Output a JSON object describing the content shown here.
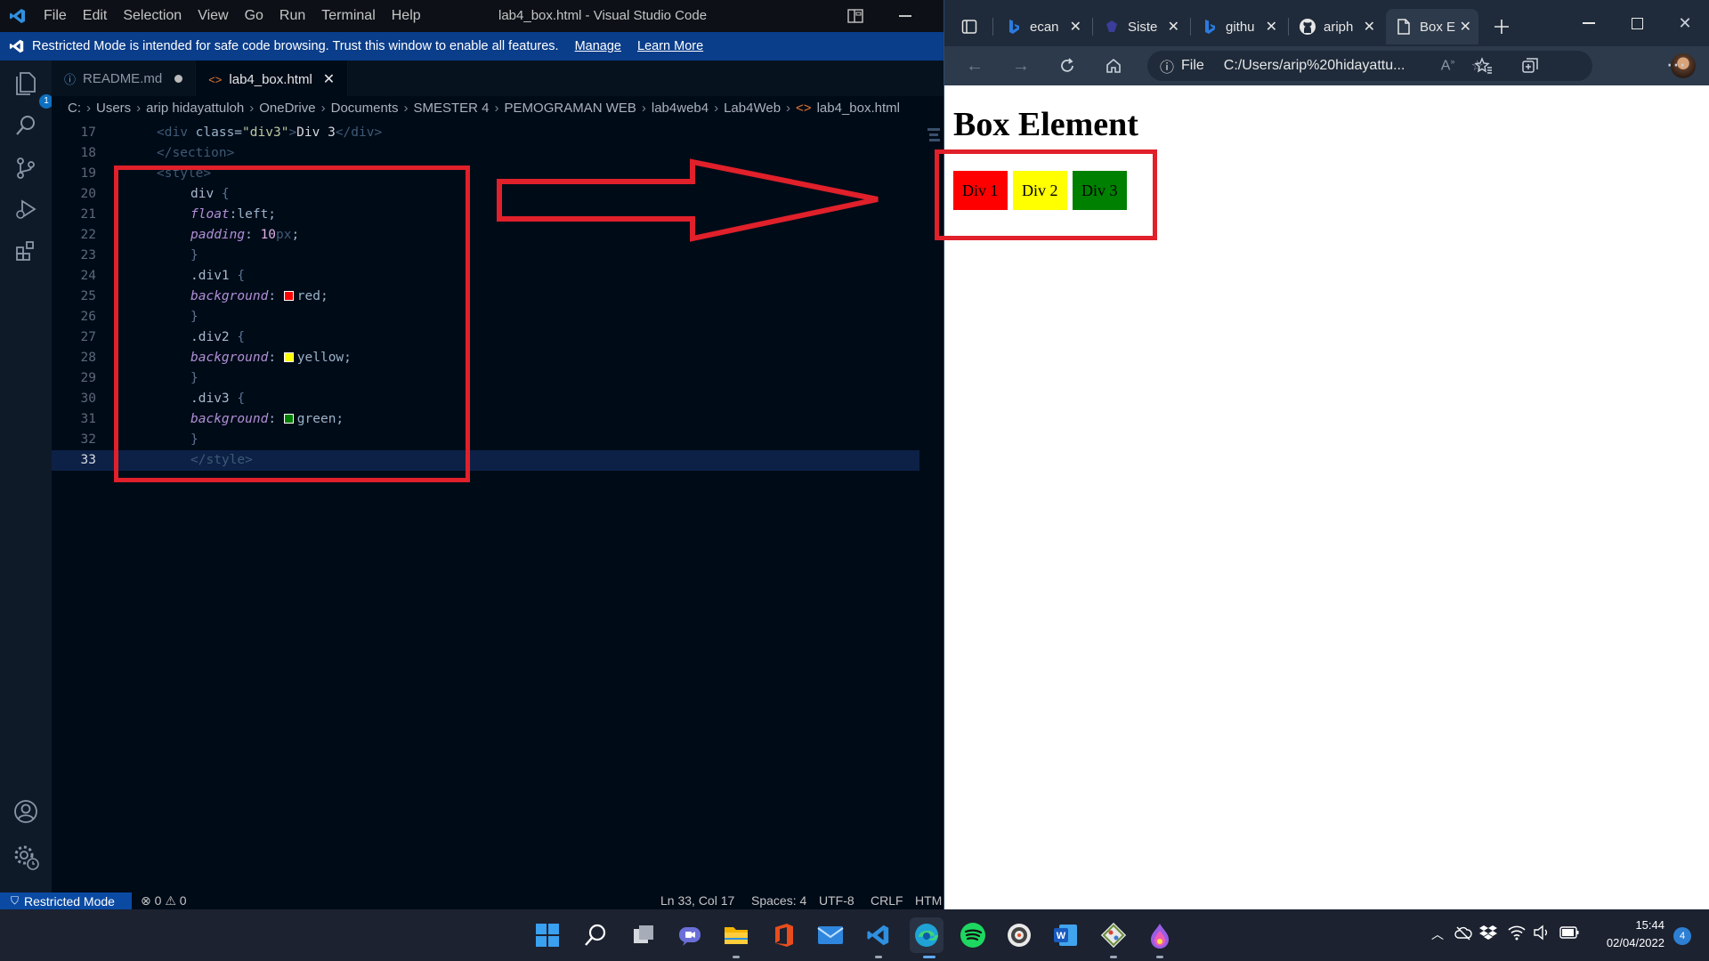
{
  "vscode": {
    "menu": [
      "File",
      "Edit",
      "Selection",
      "View",
      "Go",
      "Run",
      "Terminal",
      "Help"
    ],
    "window_title": "lab4_box.html - Visual Studio Code",
    "banner": {
      "message": "Restricted Mode is intended for safe code browsing. Trust this window to enable all features.",
      "manage": "Manage",
      "learn_more": "Learn More"
    },
    "activity_badge": "1",
    "tabs": [
      {
        "label": "README.md",
        "icon": "info-icon",
        "state": "modified"
      },
      {
        "label": "lab4_box.html",
        "icon": "html-icon",
        "state": "active"
      }
    ],
    "breadcrumb": [
      "C:",
      "Users",
      "arip hidayattuloh",
      "OneDrive",
      "Documents",
      "SMESTER 4",
      "PEMOGRAMAN WEB",
      "lab4web4",
      "Lab4Web",
      "lab4_box.html"
    ],
    "code_lines": [
      {
        "n": "17"
      },
      {
        "n": "18"
      },
      {
        "n": "19"
      },
      {
        "n": "20"
      },
      {
        "n": "21"
      },
      {
        "n": "22"
      },
      {
        "n": "23"
      },
      {
        "n": "24"
      },
      {
        "n": "25"
      },
      {
        "n": "26"
      },
      {
        "n": "27"
      },
      {
        "n": "28"
      },
      {
        "n": "29"
      },
      {
        "n": "30"
      },
      {
        "n": "31"
      },
      {
        "n": "32"
      },
      {
        "n": "33"
      }
    ],
    "code": {
      "l17_open": "<div ",
      "l17_attr": "class=",
      "l17_str": "\"div3\"",
      "l17_gt": ">",
      "l17_text": "Div 3",
      "l17_close": "</div>",
      "l18": "</section>",
      "l19": "<style>",
      "l20_sel": "div ",
      "l20_brace": "{",
      "l21_prop": "float",
      "l21_val": ":left;",
      "l22_prop": "padding",
      "l22_colon": ": ",
      "l22_num": "10",
      "l22_unit": "px",
      "l22_semi": ";",
      "l23": "}",
      "l24_sel": ".div1 ",
      "l24_brace": "{",
      "l25_prop": "background",
      "l25_colon": ": ",
      "l25_val": "red;",
      "l26": "}",
      "l27_sel": ".div2 ",
      "l27_brace": "{",
      "l28_prop": "background",
      "l28_colon": ": ",
      "l28_val": "yellow;",
      "l29": "}",
      "l30_sel": ".div3 ",
      "l30_brace": "{",
      "l31_prop": "background",
      "l31_colon": ": ",
      "l31_val": "green;",
      "l32": "}",
      "l33": "</style>"
    },
    "swatches": {
      "red": "#ff0000",
      "yellow": "#ffff00",
      "green": "#008000"
    },
    "status": {
      "restricted": "Restricted Mode",
      "errors": "0",
      "warnings": "0",
      "cursor": "Ln 33, Col 17",
      "spaces": "Spaces: 4",
      "encoding": "UTF-8",
      "eol": "CRLF",
      "language": "HTM"
    }
  },
  "edge": {
    "tabs": [
      {
        "label": "ecan",
        "icon": "bing-icon"
      },
      {
        "label": "Siste",
        "icon": "site-icon"
      },
      {
        "label": "githu",
        "icon": "bing-icon"
      },
      {
        "label": "ariph",
        "icon": "github-icon"
      },
      {
        "label": "Box E",
        "icon": "page-icon",
        "active": true
      }
    ],
    "address": {
      "scheme": "File",
      "url": "C:/Users/arip%20hidayattu..."
    },
    "page": {
      "heading": "Box Element",
      "boxes": [
        {
          "label": "Div 1",
          "color": "#ff0000"
        },
        {
          "label": "Div 2",
          "color": "#ffff00"
        },
        {
          "label": "Div 3",
          "color": "#008000"
        }
      ]
    }
  },
  "annotations": {
    "highlight_color": "#e0202a"
  },
  "taskbar": {
    "apps": [
      "start-icon",
      "search-icon",
      "task-view-icon",
      "chat-icon",
      "file-explorer-icon",
      "office-icon",
      "mail-icon",
      "vscode-icon",
      "edge-icon",
      "spotify-icon",
      "media-icon",
      "word-icon",
      "git-icon",
      "paint-icon"
    ],
    "time": "15:44",
    "date": "02/04/2022",
    "notifications": "4"
  }
}
